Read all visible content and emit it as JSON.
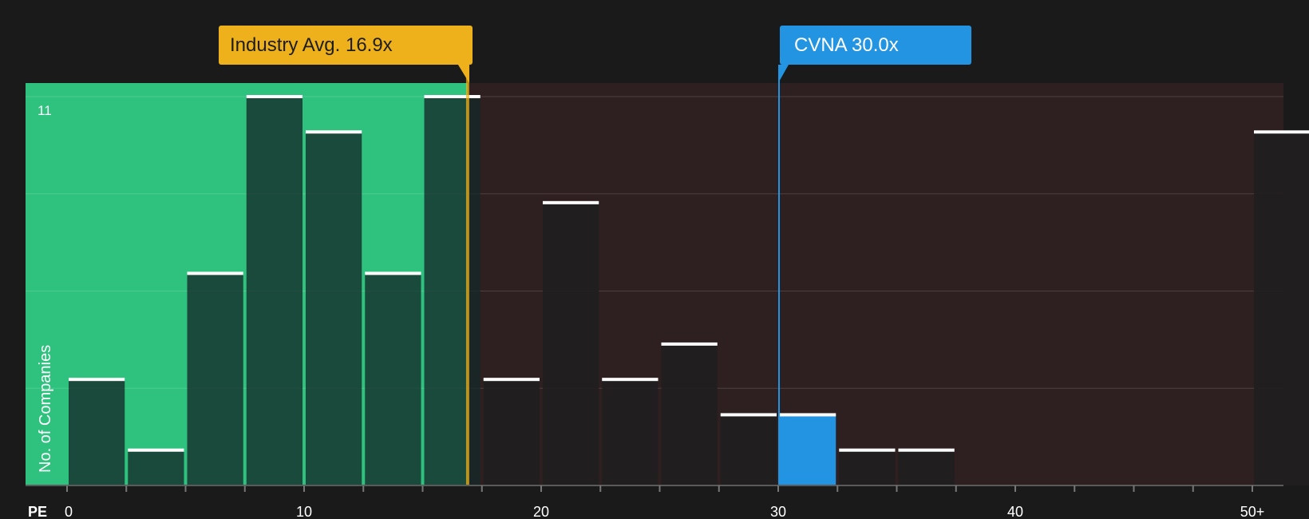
{
  "chart_data": {
    "type": "bar",
    "xlabel": "PE",
    "ylabel": "No. of Companies",
    "x_ticks": [
      "0",
      "10",
      "20",
      "30",
      "40",
      "50+"
    ],
    "y_tick_top": "11",
    "ylim": [
      0,
      11
    ],
    "bins": [
      {
        "start": 0,
        "end": 2.5,
        "value": 3
      },
      {
        "start": 2.5,
        "end": 5,
        "value": 1
      },
      {
        "start": 5,
        "end": 7.5,
        "value": 6
      },
      {
        "start": 7.5,
        "end": 10,
        "value": 11
      },
      {
        "start": 10,
        "end": 12.5,
        "value": 10
      },
      {
        "start": 12.5,
        "end": 15,
        "value": 6
      },
      {
        "start": 15,
        "end": 17.5,
        "value": 11
      },
      {
        "start": 17.5,
        "end": 20,
        "value": 3
      },
      {
        "start": 20,
        "end": 22.5,
        "value": 8
      },
      {
        "start": 22.5,
        "end": 25,
        "value": 3
      },
      {
        "start": 25,
        "end": 27.5,
        "value": 4
      },
      {
        "start": 27.5,
        "end": 30,
        "value": 2
      },
      {
        "start": 30,
        "end": 32.5,
        "value": 2,
        "highlight": true
      },
      {
        "start": 32.5,
        "end": 35,
        "value": 1
      },
      {
        "start": 35,
        "end": 37.5,
        "value": 1
      },
      {
        "start": 50,
        "end": 52.5,
        "value": 10
      }
    ],
    "industry_avg": {
      "label": "Industry Avg. 16.9x",
      "value": 16.9
    },
    "company": {
      "label": "CVNA 30.0x",
      "value": 30.0
    },
    "colors": {
      "background": "#1a1a1a",
      "undervalued_zone": "#2ec27e",
      "overvalued_zone": "#2e1f20",
      "industry": "#eeb11b",
      "company": "#2394e1",
      "bar_cap": "#ffffff"
    }
  }
}
